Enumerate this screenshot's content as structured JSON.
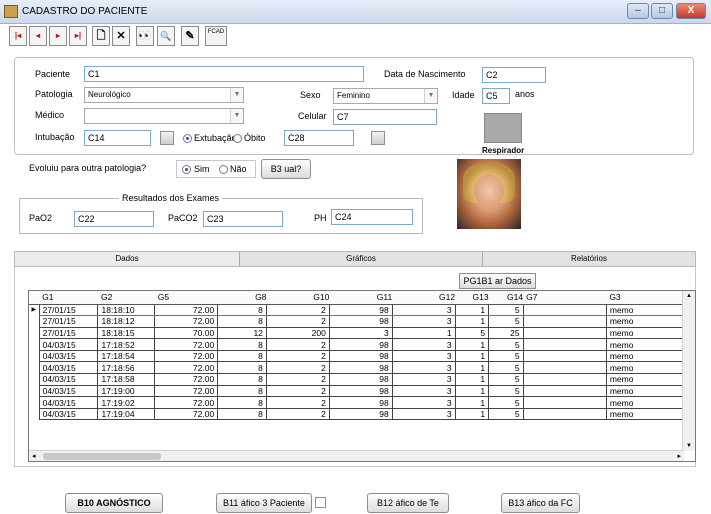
{
  "window": {
    "title": "CADASTRO DO PACIENTE",
    "min": "–",
    "max": "□",
    "close": "X"
  },
  "toolbar": {
    "first": "|◂",
    "prev": "◂",
    "next": "▸",
    "last": "▸|",
    "new": "🗋",
    "delete": "✕",
    "find": "👀",
    "zoom": "🔍",
    "edit": "✎",
    "fcad": "FCAD"
  },
  "form": {
    "paciente_label": "Paciente",
    "paciente_value": "C1",
    "nascimento_label": "Data de Nascimento",
    "nascimento_value": "C2",
    "patologia_label": "Patologia",
    "patologia_value": "Neurológico",
    "sexo_label": "Sexo",
    "sexo_value": "Feminino",
    "idade_label": "Idade",
    "idade_value": "C5",
    "anos_label": "anos",
    "medico_label": "Médico",
    "medico_value": "",
    "celular_label": "Celular",
    "celular_value": "C7",
    "intubacao_label": "Intubação",
    "intubacao_value": "C14",
    "extubacao_label": "Extubação",
    "obito_label": "Óbito",
    "obito_value": "C28",
    "respirador_label": "Respirador"
  },
  "evolution": {
    "question": "Evoluiu para outra patologia?",
    "sim": "Sim",
    "nao": "Não",
    "qual_button": "B3 ual?"
  },
  "exams": {
    "legend": "Resultados dos Exames",
    "pao2_label": "PaO2",
    "pao2_value": "C22",
    "paco2_label": "PaCO2",
    "paco2_value": "C23",
    "ph_label": "PH",
    "ph_value": "C24"
  },
  "tabs": [
    "Dados",
    "Gráficos",
    "Relatórios"
  ],
  "gerar_button": "PG1B1 ar Dados",
  "grid": {
    "headers": [
      "G1",
      "G2",
      "G5",
      "G8",
      "G10",
      "G11",
      "G12",
      "G13",
      "G14",
      "G7",
      "G3"
    ],
    "rows": [
      [
        "27/01/15",
        "18:18:10",
        "72.00",
        "8",
        "2",
        "98",
        "3",
        "1",
        "5",
        "",
        "memo"
      ],
      [
        "27/01/15",
        "18:18:12",
        "72.00",
        "8",
        "2",
        "98",
        "3",
        "1",
        "5",
        "",
        "memo"
      ],
      [
        "27/01/15",
        "18:18:15",
        "70.00",
        "12",
        "200",
        "3",
        "1",
        "5",
        "25",
        "",
        "memo"
      ],
      [
        "04/03/15",
        "17:18:52",
        "72.00",
        "8",
        "2",
        "98",
        "3",
        "1",
        "5",
        "",
        "memo"
      ],
      [
        "04/03/15",
        "17:18:54",
        "72.00",
        "8",
        "2",
        "98",
        "3",
        "1",
        "5",
        "",
        "memo"
      ],
      [
        "04/03/15",
        "17:18:56",
        "72.00",
        "8",
        "2",
        "98",
        "3",
        "1",
        "5",
        "",
        "memo"
      ],
      [
        "04/03/15",
        "17:18:58",
        "72.00",
        "8",
        "2",
        "98",
        "3",
        "1",
        "5",
        "",
        "memo"
      ],
      [
        "04/03/15",
        "17:19:00",
        "72.00",
        "8",
        "2",
        "98",
        "3",
        "1",
        "5",
        "",
        "memo"
      ],
      [
        "04/03/15",
        "17:19:02",
        "72.00",
        "8",
        "2",
        "98",
        "3",
        "1",
        "5",
        "",
        "memo"
      ],
      [
        "04/03/15",
        "17:19:04",
        "72.00",
        "8",
        "2",
        "98",
        "3",
        "1",
        "5",
        "",
        "memo"
      ]
    ]
  },
  "bottom": {
    "diagnostico": "B10 AGNÓSTICO",
    "grafico_paciente": "B11 áfico 3 Paciente",
    "grafico_te": "B12 áfico de Te",
    "grafico_fc": "B13 áfico da FC"
  }
}
